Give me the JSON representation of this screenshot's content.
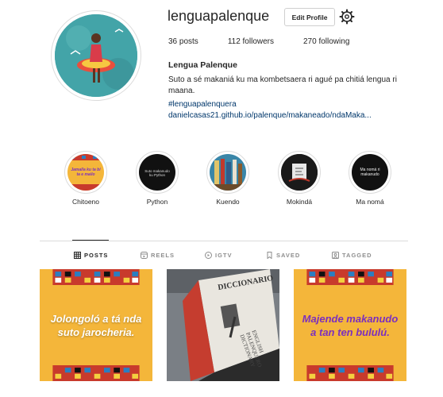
{
  "profile": {
    "username": "lenguapalenque",
    "edit_label": "Edit Profile",
    "stats": {
      "posts": "36 posts",
      "followers": "112 followers",
      "following": "270 following"
    },
    "display_name": "Lengua Palenque",
    "bio": "Suto a sé makaniá ku ma kombetsaera ri agué pa chitiá lengua ri maana.",
    "hashtag": "#lenguapalenquera",
    "link": "danielcasas21.github.io/palenque/makaneado/ndaMaka..."
  },
  "highlights": [
    {
      "label": "Chitoeno",
      "thumb_text": "Jamalla ku ta bi ta e mailo"
    },
    {
      "label": "Python",
      "thumb_text": "Suto makanudo ku Python"
    },
    {
      "label": "Kuendo",
      "thumb_text": ""
    },
    {
      "label": "Mokindá",
      "thumb_text": ""
    },
    {
      "label": "Ma nomá",
      "thumb_text": "Ma nomá ri makanudo"
    }
  ],
  "tabs": [
    {
      "label": "POSTS",
      "icon": "grid-icon"
    },
    {
      "label": "REELS",
      "icon": "reels-icon"
    },
    {
      "label": "IGTV",
      "icon": "igtv-icon"
    },
    {
      "label": "SAVED",
      "icon": "bookmark-icon"
    },
    {
      "label": "TAGGED",
      "icon": "tagged-icon"
    }
  ],
  "posts": [
    {
      "text": "Jolongoló a tá nda suto jarocheria.",
      "text_color": "#ffffff"
    },
    {
      "text": "",
      "book_title": "DICCIONARIO",
      "book_subtitle": "ENGLISH PALENQUERO DICTIONARY"
    },
    {
      "text": "Majende makanudo a tan ten bululú.",
      "text_color": "#7b2fbf"
    }
  ],
  "colors": {
    "accent_link": "#00376b",
    "post_yellow": "#f4b63a",
    "border": "#dbdbdb"
  }
}
